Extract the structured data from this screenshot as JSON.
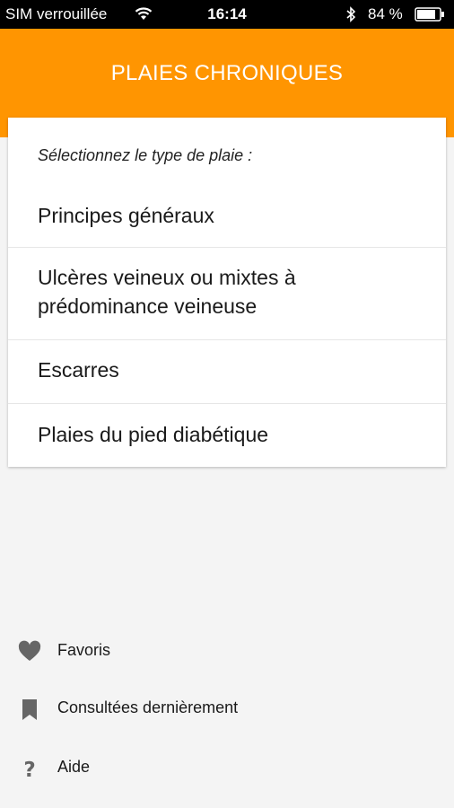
{
  "status_bar": {
    "carrier": "SIM verrouillée",
    "time": "16:14",
    "battery_percent": "84 %",
    "icons": [
      "wifi-icon",
      "bluetooth-icon",
      "battery-icon"
    ]
  },
  "header": {
    "title": "PLAIES CHRONIQUES",
    "background_color": "#ff9501"
  },
  "card": {
    "subtitle": "Sélectionnez le type de plaie :",
    "items": [
      {
        "line1": "Principes généraux",
        "line2": ""
      },
      {
        "line1": "Ulcères veineux ou mixtes à",
        "line2": "prédominance veineuse"
      },
      {
        "line1": "Escarres",
        "line2": ""
      },
      {
        "line1": "Plaies du pied diabétique",
        "line2": ""
      }
    ]
  },
  "bottom_menu": {
    "items": [
      {
        "label": "Favoris",
        "icon": "heart-icon"
      },
      {
        "label": "Consultées dernièrement",
        "icon": "bookmark-icon"
      },
      {
        "label": "Aide",
        "icon": "question-icon"
      }
    ]
  }
}
